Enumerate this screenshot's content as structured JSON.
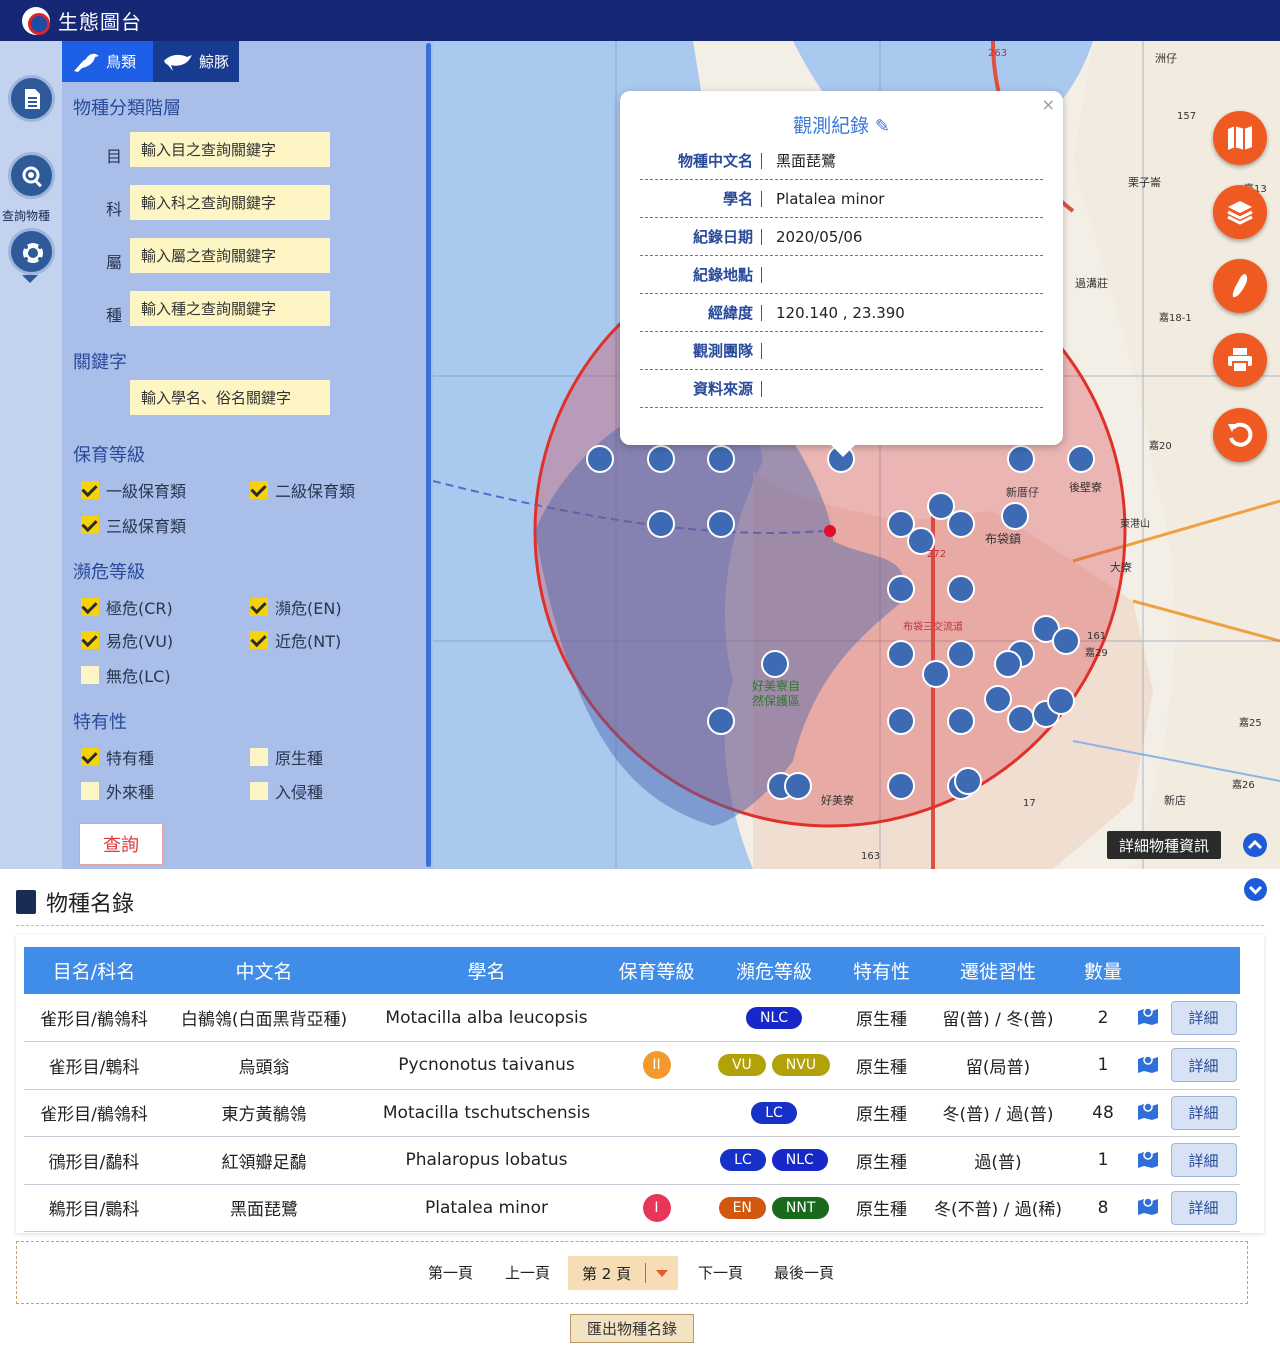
{
  "app": {
    "title": "生態圖台"
  },
  "rail": {
    "query_label": "查詢物種"
  },
  "tabs": [
    {
      "label": "鳥類"
    },
    {
      "label": "鯨豚"
    }
  ],
  "filters": {
    "taxonomy_title": "物種分類階層",
    "rows": [
      {
        "label": "目",
        "placeholder": "輸入目之查詢關鍵字"
      },
      {
        "label": "科",
        "placeholder": "輸入科之查詢關鍵字"
      },
      {
        "label": "屬",
        "placeholder": "輸入屬之查詢關鍵字"
      },
      {
        "label": "種",
        "placeholder": "輸入種之查詢關鍵字"
      }
    ],
    "keyword_title": "關鍵字",
    "keyword_placeholder": "輸入學名、俗名關鍵字",
    "protection_title": "保育等級",
    "protection": [
      {
        "label": "一級保育類",
        "checked": true
      },
      {
        "label": "二級保育類",
        "checked": true
      },
      {
        "label": "三級保育類",
        "checked": true
      }
    ],
    "endangered_title": "瀕危等級",
    "endangered": [
      {
        "label": "極危(CR)",
        "checked": true
      },
      {
        "label": "瀕危(EN)",
        "checked": true
      },
      {
        "label": "易危(VU)",
        "checked": true
      },
      {
        "label": "近危(NT)",
        "checked": true
      },
      {
        "label": "無危(LC)",
        "checked": false
      }
    ],
    "endemic_title": "特有性",
    "endemic": [
      {
        "label": "特有種",
        "checked": true
      },
      {
        "label": "原生種",
        "checked": false
      },
      {
        "label": "外來種",
        "checked": false
      },
      {
        "label": "入侵種",
        "checked": false
      }
    ],
    "query_label": "查詢"
  },
  "map": {
    "labels": [
      "好美寮自",
      "然保護區",
      "布袋鎮",
      "新厝仔",
      "後壁寮",
      "好美寮",
      "過溝莊",
      "栗子崙",
      "新店",
      "洲仔",
      "布袋三交流道",
      "272",
      "263",
      "163",
      "157",
      "17",
      "161",
      "嘉20",
      "嘉25",
      "嘉26",
      "嘉29",
      "嘉13",
      "嘉18-1",
      "東港山",
      "大寮"
    ],
    "detail_label": "詳細物種資訊"
  },
  "popup": {
    "title": "觀測紀錄",
    "close": "×",
    "rows": [
      {
        "key": "物種中文名",
        "value": "黑面琵鷺"
      },
      {
        "key": "學名",
        "value": "Platalea minor"
      },
      {
        "key": "紀錄日期",
        "value": "2020/05/06"
      },
      {
        "key": "紀錄地點",
        "value": ""
      },
      {
        "key": "經緯度",
        "value": "120.140 , 23.390"
      },
      {
        "key": "觀測團隊",
        "value": ""
      },
      {
        "key": "資料來源",
        "value": ""
      }
    ]
  },
  "species_list": {
    "title": "物種名錄",
    "headers": [
      "目名/科名",
      "中文名",
      "學名",
      "保育等級",
      "瀕危等級",
      "特有性",
      "遷徙習性",
      "數量",
      "",
      ""
    ],
    "rows": [
      {
        "order": "雀形目/鶺鴒科",
        "name": "白鶺鴒(白面黑背亞種)",
        "sci": "Motacilla alba leucopsis",
        "prot": "",
        "badges": [
          {
            "t": "NLC",
            "c": "b-nlc"
          }
        ],
        "endemic": "原生種",
        "migration": "留(普) / 冬(普)",
        "count": "2",
        "detail": "詳細"
      },
      {
        "order": "雀形目/鵯科",
        "name": "烏頭翁",
        "sci": "Pycnonotus taivanus",
        "prot": "II",
        "badges": [
          {
            "t": "VU",
            "c": "b-vu"
          },
          {
            "t": "NVU",
            "c": "b-vu"
          }
        ],
        "endemic": "原生種",
        "migration": "留(局普)",
        "count": "1",
        "detail": "詳細"
      },
      {
        "order": "雀形目/鶺鴒科",
        "name": "東方黃鶺鴒",
        "sci": "Motacilla tschutschensis",
        "prot": "",
        "badges": [
          {
            "t": "LC",
            "c": "b-lc"
          }
        ],
        "endemic": "原生種",
        "migration": "冬(普) / 過(普)",
        "count": "48",
        "detail": "詳細"
      },
      {
        "order": "鴴形目/鷸科",
        "name": "紅領瓣足鷸",
        "sci": "Phalaropus lobatus",
        "prot": "",
        "badges": [
          {
            "t": "LC",
            "c": "b-lc"
          },
          {
            "t": "NLC",
            "c": "b-nlc"
          }
        ],
        "endemic": "原生種",
        "migration": "過(普)",
        "count": "1",
        "detail": "詳細"
      },
      {
        "order": "鵜形目/䴉科",
        "name": "黑面琵鷺",
        "sci": "Platalea minor",
        "prot": "I",
        "badges": [
          {
            "t": "EN",
            "c": "b-en"
          },
          {
            "t": "NNT",
            "c": "b-nnt"
          }
        ],
        "endemic": "原生種",
        "migration": "冬(不普) / 過(稀)",
        "count": "8",
        "detail": "詳細"
      }
    ]
  },
  "pager": {
    "first": "第一頁",
    "prev": "上一頁",
    "current": "第 2 頁",
    "next": "下一頁",
    "last": "最後一頁"
  },
  "export_label": "匯出物種名錄"
}
